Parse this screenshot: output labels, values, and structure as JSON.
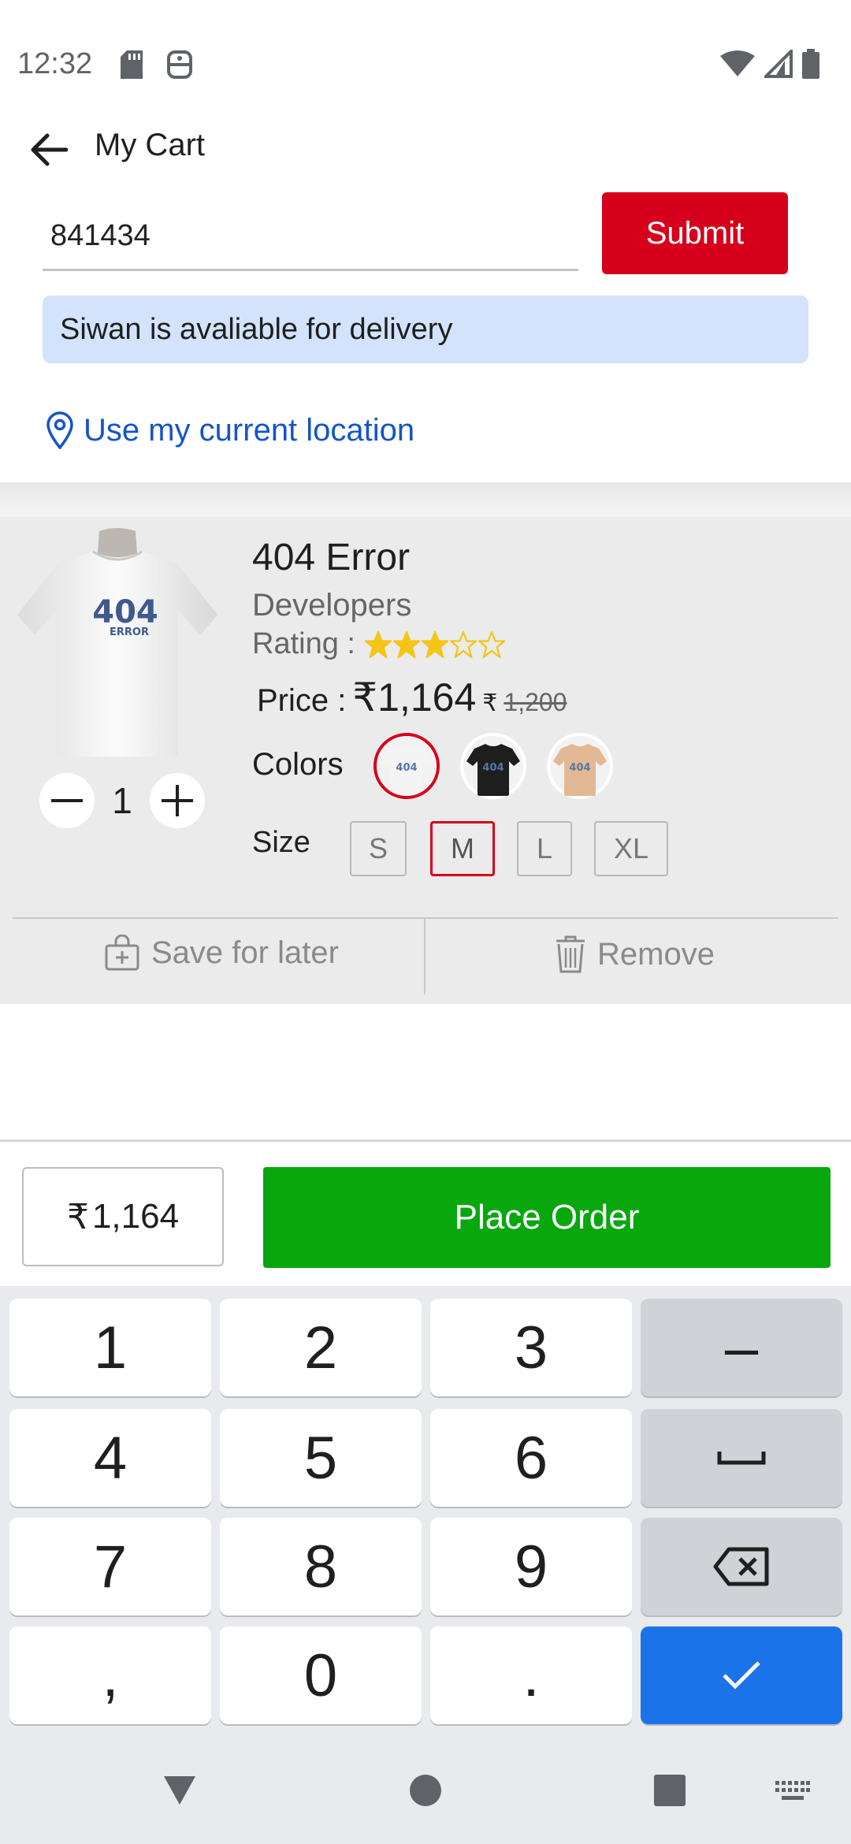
{
  "status_bar": {
    "time": "12:32"
  },
  "app_bar": {
    "title": "My Cart"
  },
  "pincode": {
    "value": "841434",
    "submit_label": "Submit"
  },
  "delivery_message": "Siwan is avaliable for delivery",
  "location_link": "Use my current location",
  "cart_item": {
    "name": "404 Error",
    "brand": "Developers",
    "rating_label": "Rating :",
    "rating": 3,
    "rating_max": 5,
    "price_label": "Price :",
    "currency": "₹",
    "price": "1,164",
    "original_price": "1,200",
    "quantity": "1",
    "colors_label": "Colors",
    "colors": [
      {
        "name": "white",
        "hex": "#f4f4f4",
        "selected": true
      },
      {
        "name": "black",
        "hex": "#1e1e1e",
        "selected": false
      },
      {
        "name": "beige",
        "hex": "#e3b894",
        "selected": false
      }
    ],
    "size_label": "Size",
    "sizes": [
      "S",
      "M",
      "L",
      "XL"
    ],
    "selected_size": "M",
    "save_for_later": "Save for later",
    "remove": "Remove",
    "image_text": {
      "code": "404",
      "word": "ERROR"
    }
  },
  "footer": {
    "total": "1,164",
    "place_order": "Place Order"
  },
  "keyboard": {
    "rows": [
      [
        "1",
        "2",
        "3",
        "–"
      ],
      [
        "4",
        "5",
        "6",
        "space"
      ],
      [
        "7",
        "8",
        "9",
        "backspace"
      ],
      [
        ",",
        "0",
        ".",
        "done"
      ]
    ]
  },
  "colors": {
    "accent_red": "#d6001c",
    "link_blue": "#1654c8",
    "place_order_green": "#08a70e",
    "info_bg": "#d4e3fc",
    "star_yellow": "#f5c518",
    "keyboard_done": "#1a73e8"
  }
}
